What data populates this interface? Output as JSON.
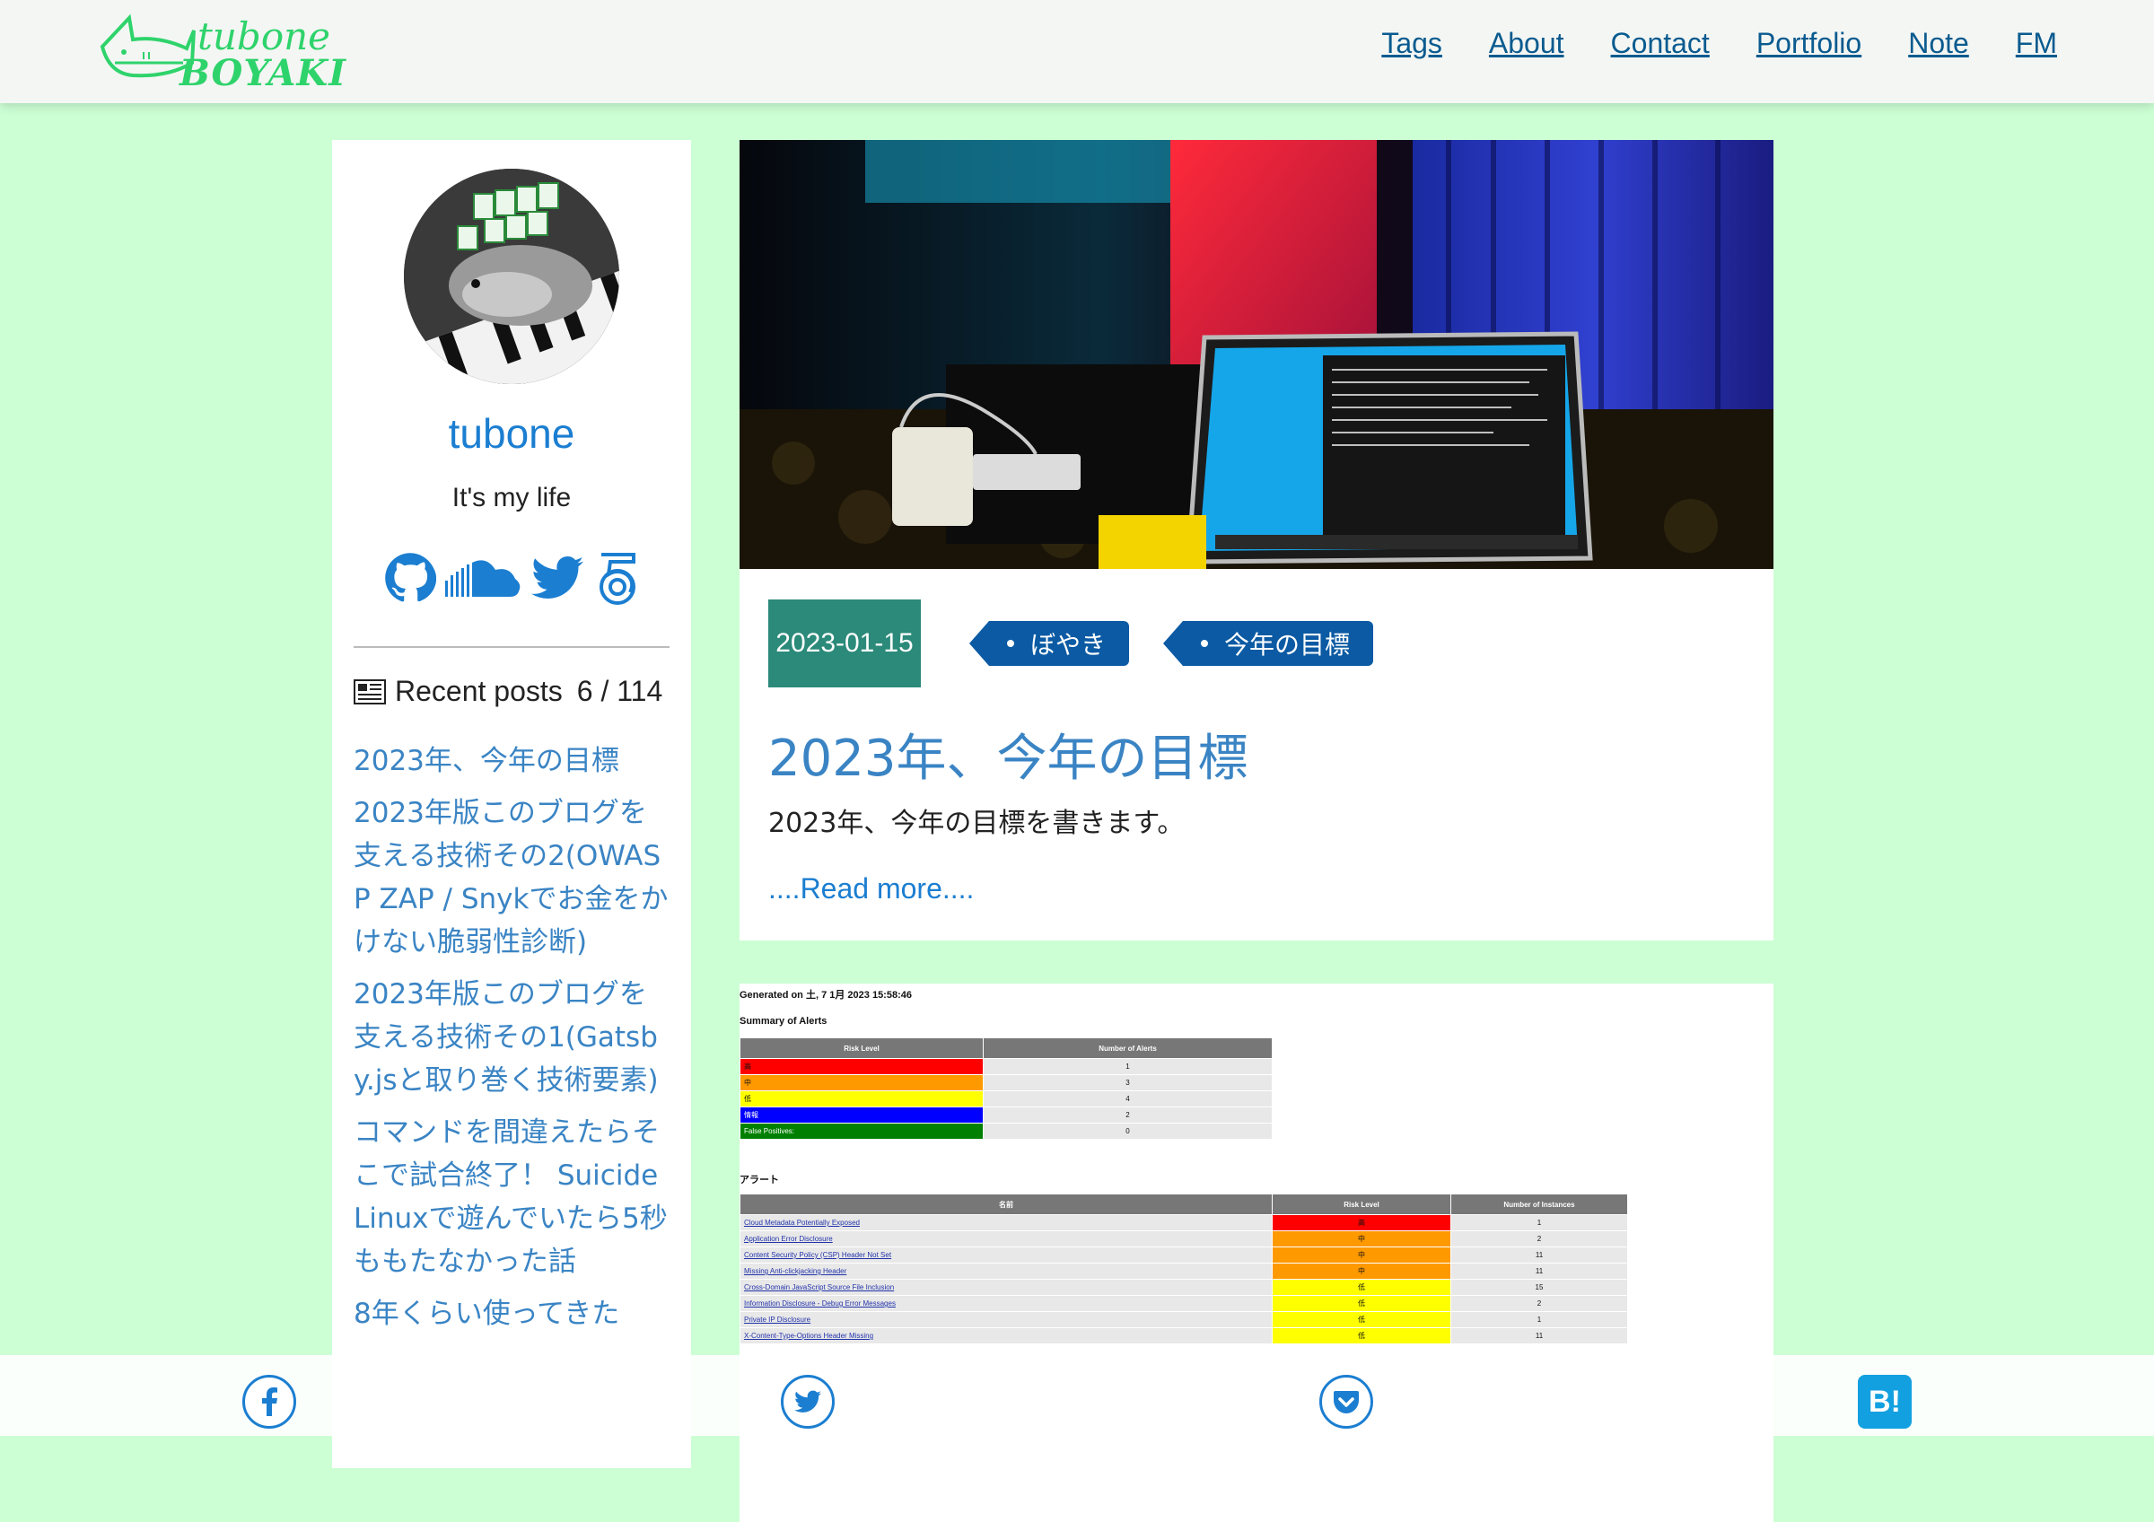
{
  "header": {
    "logo_line1": "tubone",
    "logo_line2": "BOYAKI",
    "nav": [
      "Tags",
      "About",
      "Contact",
      "Portfolio",
      "Note",
      "FM"
    ]
  },
  "sidebar": {
    "name": "tubone",
    "tagline": "It's my life",
    "social_icons": [
      "github-icon",
      "soundcloud-icon",
      "twitter-icon",
      "podcast-icon"
    ],
    "recent_label": "Recent posts",
    "recent_count": "6 / 114",
    "recent_posts": [
      "2023年、今年の目標",
      "2023年版このブログを支える技術その2(OWASP ZAP / Snykでお金をかけない脆弱性診断)",
      "2023年版このブログを支える技術その1(Gatsby.jsと取り巻く技術要素)",
      "コマンドを間違えたらそこで試合終了！ Suicide Linuxで遊んでいたら5秒ももたなかった話",
      "8年くらい使ってきた"
    ]
  },
  "post": {
    "date": "2023-01-15",
    "tags": [
      "ぼやき",
      "今年の目標"
    ],
    "title": "2023年、今年の目標",
    "excerpt": "2023年、今年の目標を書きます。",
    "read_more": "....Read more...."
  },
  "report": {
    "generated": "Generated on 土, 7 1月 2023 15:58:46",
    "summary_title": "Summary of Alerts",
    "summary_headers": [
      "Risk Level",
      "Number of Alerts"
    ],
    "summary_rows": [
      {
        "level": "高",
        "count": "1",
        "color": "#ff0000"
      },
      {
        "level": "中",
        "count": "3",
        "color": "#ff9900"
      },
      {
        "level": "低",
        "count": "4",
        "color": "#ffff00"
      },
      {
        "level": "情報",
        "count": "2",
        "color": "#0000ff"
      },
      {
        "level": "False Positives:",
        "count": "0",
        "color": "#008000"
      }
    ],
    "alerts_title": "アラート",
    "alerts_headers": [
      "名前",
      "Risk Level",
      "Number of Instances"
    ],
    "alerts_rows": [
      {
        "name": "Cloud Metadata Potentially Exposed",
        "risk": "高",
        "count": "1",
        "color": "#ff0000"
      },
      {
        "name": "Application Error Disclosure",
        "risk": "中",
        "count": "2",
        "color": "#ff9900"
      },
      {
        "name": "Content Security Policy (CSP) Header Not Set",
        "risk": "中",
        "count": "11",
        "color": "#ff9900"
      },
      {
        "name": "Missing Anti-clickjacking Header",
        "risk": "中",
        "count": "11",
        "color": "#ff9900"
      },
      {
        "name": "Cross-Domain JavaScript Source File Inclusion",
        "risk": "低",
        "count": "15",
        "color": "#ffff00"
      },
      {
        "name": "Information Disclosure - Debug Error Messages",
        "risk": "低",
        "count": "2",
        "color": "#ffff00"
      },
      {
        "name": "Private IP Disclosure",
        "risk": "低",
        "count": "1",
        "color": "#ffff00"
      },
      {
        "name": "X-Content-Type-Options Header Missing",
        "risk": "低",
        "count": "11",
        "color": "#ffff00"
      }
    ]
  },
  "share": [
    "facebook-icon",
    "twitter-icon",
    "pocket-icon",
    "hatena-bookmark-icon"
  ],
  "hatena_label": "B!"
}
